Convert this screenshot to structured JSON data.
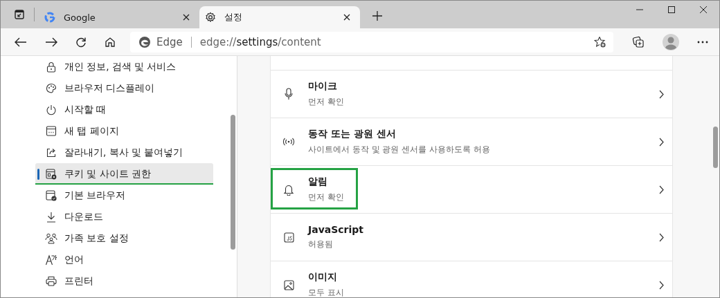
{
  "tabs": [
    {
      "title": "Google",
      "kind": "google",
      "selected": false
    },
    {
      "title": "설정",
      "kind": "gear",
      "selected": true
    }
  ],
  "address_bar": {
    "site_label": "Edge",
    "url_parts": [
      {
        "text": "edge://",
        "emphasis": false
      },
      {
        "text": "settings",
        "emphasis": true
      },
      {
        "text": "/content",
        "emphasis": false
      }
    ]
  },
  "sidebar": {
    "items": [
      {
        "label": "개인 정보, 검색 및 서비스",
        "kind": "lock",
        "selected": false,
        "highlighted": false
      },
      {
        "label": "브라우저 디스플레이",
        "kind": "palette",
        "selected": false,
        "highlighted": false
      },
      {
        "label": "시작할 때",
        "kind": "power",
        "selected": false,
        "highlighted": false
      },
      {
        "label": "새 탭 페이지",
        "kind": "newtab",
        "selected": false,
        "highlighted": false
      },
      {
        "label": "잘라내기, 복사 및 붙여넣기",
        "kind": "share",
        "selected": false,
        "highlighted": false
      },
      {
        "label": "쿠키 및 사이트 권한",
        "kind": "cookie",
        "selected": true,
        "highlighted": true
      },
      {
        "label": "기본 브라우저",
        "kind": "browser",
        "selected": false,
        "highlighted": false
      },
      {
        "label": "다운로드",
        "kind": "download",
        "selected": false,
        "highlighted": false
      },
      {
        "label": "가족 보호 설정",
        "kind": "family",
        "selected": false,
        "highlighted": false
      },
      {
        "label": "언어",
        "kind": "language",
        "selected": false,
        "highlighted": false
      },
      {
        "label": "프린터",
        "kind": "printer",
        "selected": false,
        "highlighted": false
      }
    ]
  },
  "permissions": [
    {
      "title": "마이크",
      "subtitle": "먼저 확인",
      "kind": "mic",
      "highlighted": false
    },
    {
      "title": "동작 또는 광원 센서",
      "subtitle": "사이트에서 동작 및 광원 센서를 사용하도록 허용",
      "kind": "sensor",
      "highlighted": false
    },
    {
      "title": "알림",
      "subtitle": "먼저 확인",
      "kind": "bell",
      "highlighted": true
    },
    {
      "title": "JavaScript",
      "subtitle": "허용됨",
      "kind": "js",
      "highlighted": false
    },
    {
      "title": "이미지",
      "subtitle": "모두 표시",
      "kind": "image",
      "highlighted": false
    }
  ]
}
